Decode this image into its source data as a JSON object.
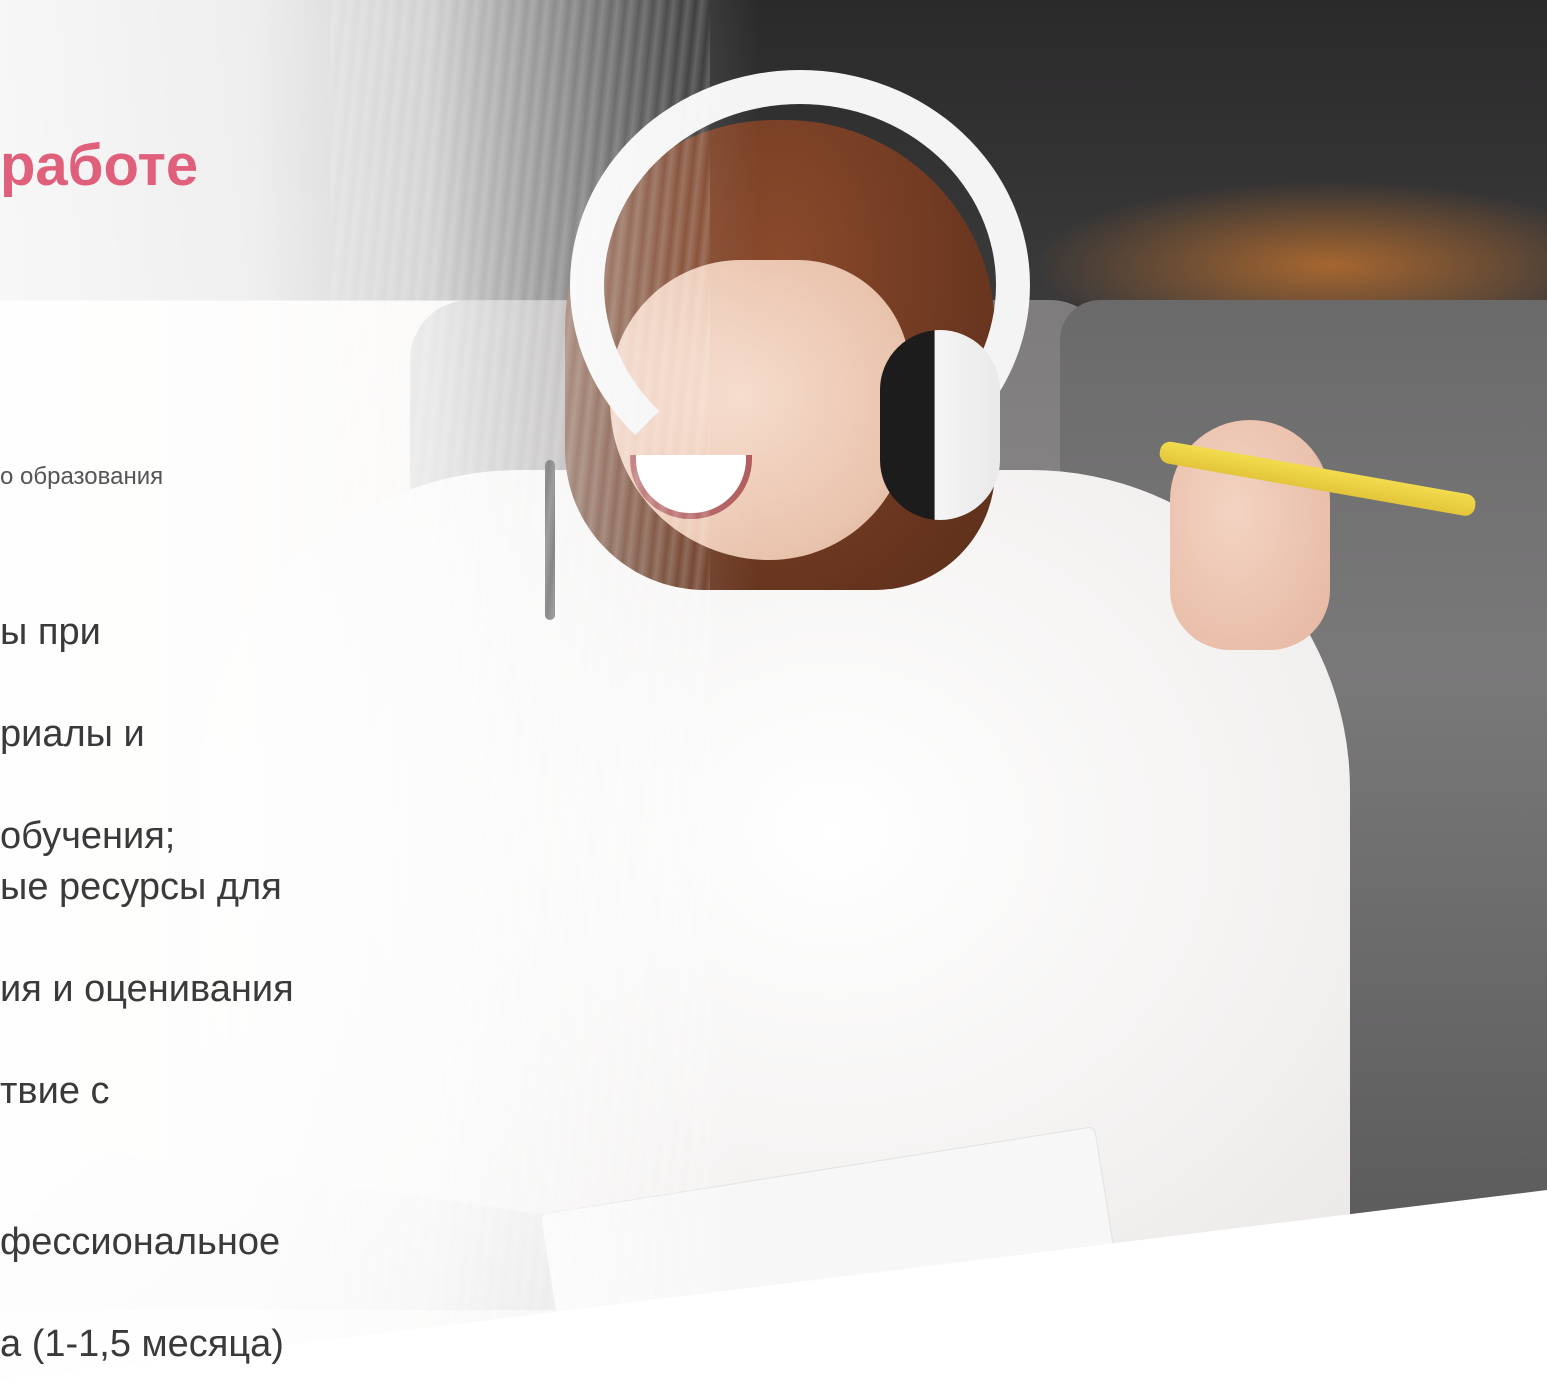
{
  "header": {
    "title": "работе",
    "subtitle": "о образования"
  },
  "items": [
    {
      "lines": [
        "ы при"
      ]
    },
    {
      "lines": [
        "риалы и"
      ]
    },
    {
      "lines": [
        "обучения;",
        "ые ресурсы для"
      ]
    },
    {
      "lines": [
        "ия и оценивания"
      ]
    },
    {
      "lines": [
        "твие с"
      ]
    },
    {
      "lines": [
        "фессиональное"
      ]
    },
    {
      "lines": [
        "а (1-1,5 месяца)"
      ]
    }
  ],
  "colors": {
    "accent": "#e0607c",
    "text": "#3a3a3a"
  },
  "icons": [
    "photo-woman-headphones"
  ]
}
